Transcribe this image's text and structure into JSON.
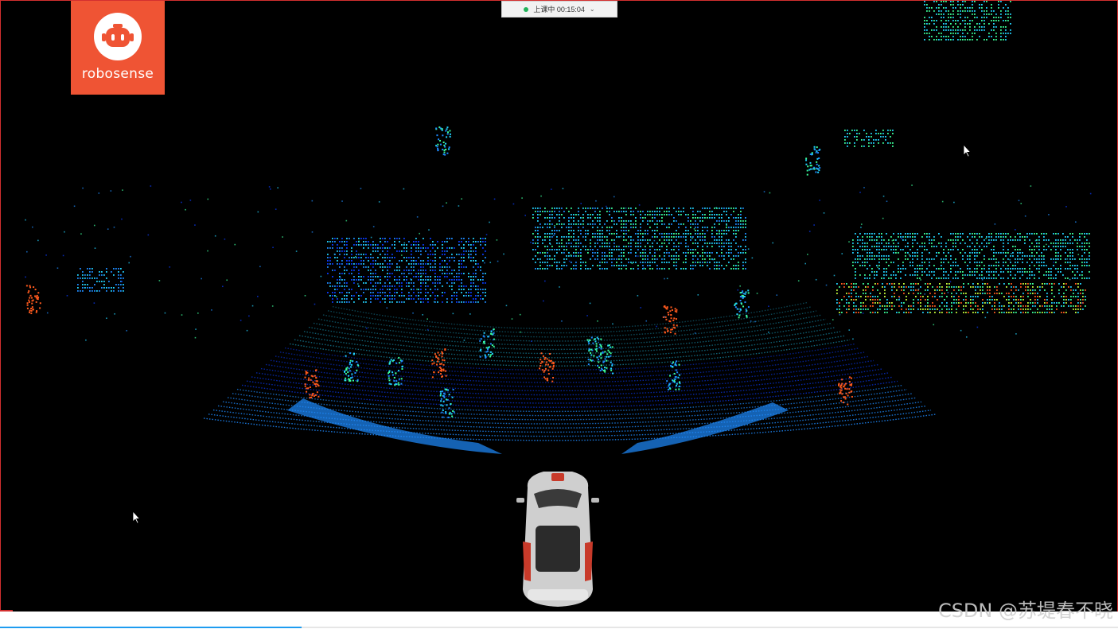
{
  "logo": {
    "text": "robosense",
    "color": "#ef5434"
  },
  "status": {
    "label": "上课中 00:15:04",
    "dot_color": "#21b35a",
    "chevron_icon": "chevron-down-icon"
  },
  "player": {
    "progress": 0.27,
    "progress_color": "#1e9cf0"
  },
  "watermark": {
    "text": "CSDN @苏堤春不晓"
  },
  "scene": {
    "background": "#000000",
    "point_cloud_colors": [
      "#0a3cff",
      "#1e8bff",
      "#22d3ff",
      "#3cff9a",
      "#c8ff3c",
      "#ff5a1e"
    ]
  }
}
